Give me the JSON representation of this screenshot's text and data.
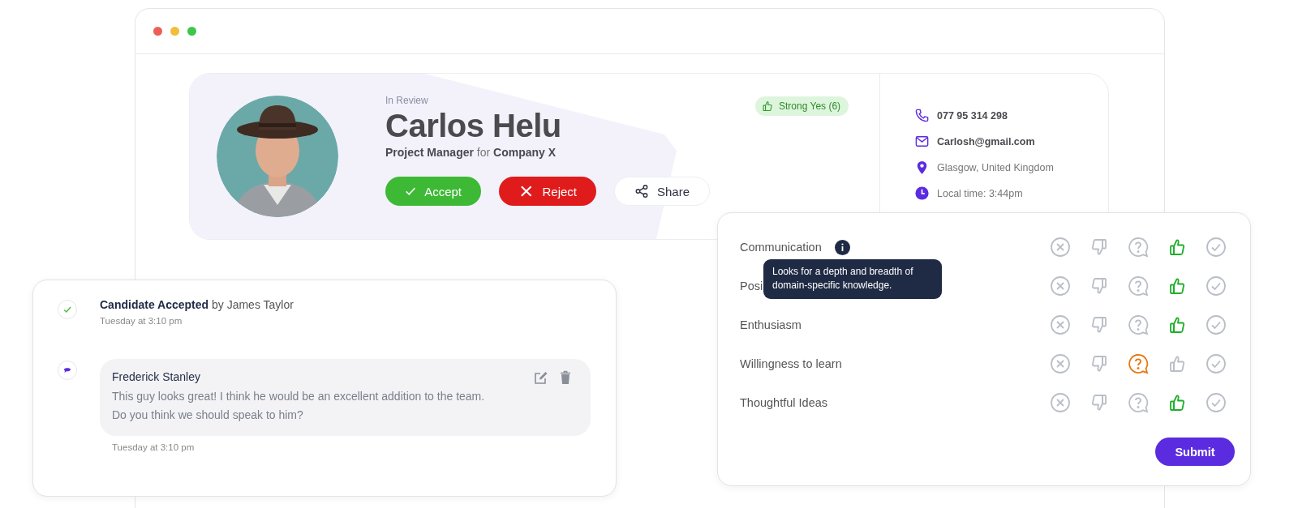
{
  "profile": {
    "status": "In Review",
    "name": "Carlos Helu",
    "subtitle": "**Project Manager** for **Company X**",
    "verdict": "Strong Yes (6)",
    "actions": [
      {
        "kind": "accept",
        "label": "Accept"
      },
      {
        "kind": "reject",
        "label": "Reject"
      },
      {
        "kind": "share",
        "label": "Share"
      }
    ]
  },
  "contact": [
    {
      "kind": "phone",
      "text": "077 95 314 298"
    },
    {
      "kind": "email",
      "text": "Carlosh@gmail.com"
    },
    {
      "kind": "location",
      "text": "Glasgow, United Kingdom"
    },
    {
      "kind": "time",
      "text": "Local time: 3:44pm"
    }
  ],
  "ratings": {
    "tooltip": "Looks for a depth and breadth of domain-specific knowledge.",
    "submit": "Submit",
    "rows": [
      {
        "label": "Communication",
        "info": true,
        "options": [
          {
            "kind": "no",
            "selected": false
          },
          {
            "kind": "down",
            "selected": false
          },
          {
            "kind": "maybe",
            "selected": false
          },
          {
            "kind": "yes",
            "selected": true
          },
          {
            "kind": "strong",
            "selected": false
          }
        ]
      },
      {
        "label": "Posi",
        "info": false,
        "options": [
          {
            "kind": "no",
            "selected": false
          },
          {
            "kind": "down",
            "selected": false
          },
          {
            "kind": "maybe",
            "selected": false
          },
          {
            "kind": "yes",
            "selected": true
          },
          {
            "kind": "strong",
            "selected": false
          }
        ]
      },
      {
        "label": "Enthusiasm",
        "info": false,
        "options": [
          {
            "kind": "no",
            "selected": false
          },
          {
            "kind": "down",
            "selected": false
          },
          {
            "kind": "maybe",
            "selected": false
          },
          {
            "kind": "yes",
            "selected": true
          },
          {
            "kind": "strong",
            "selected": false
          }
        ]
      },
      {
        "label": "Willingness to learn",
        "info": false,
        "options": [
          {
            "kind": "no",
            "selected": false
          },
          {
            "kind": "down",
            "selected": false
          },
          {
            "kind": "maybe",
            "selected": true
          },
          {
            "kind": "yes",
            "selected": false
          },
          {
            "kind": "strong",
            "selected": false
          }
        ]
      },
      {
        "label": "Thoughtful Ideas",
        "info": false,
        "options": [
          {
            "kind": "no",
            "selected": false
          },
          {
            "kind": "down",
            "selected": false
          },
          {
            "kind": "maybe",
            "selected": false
          },
          {
            "kind": "yes",
            "selected": true
          },
          {
            "kind": "strong",
            "selected": false
          }
        ]
      }
    ]
  },
  "activity": [
    {
      "kind": "event",
      "text": "**Candidate Accepted** by James Taylor",
      "time": "Tuesday at 3:10 pm"
    },
    {
      "kind": "comment",
      "author": "Frederick Stanley",
      "text": "This guy looks great! I think he would be an excellent addition to the team.\nDo you think we should speak to him?",
      "time": "Tuesday at 3:10 pm"
    }
  ]
}
